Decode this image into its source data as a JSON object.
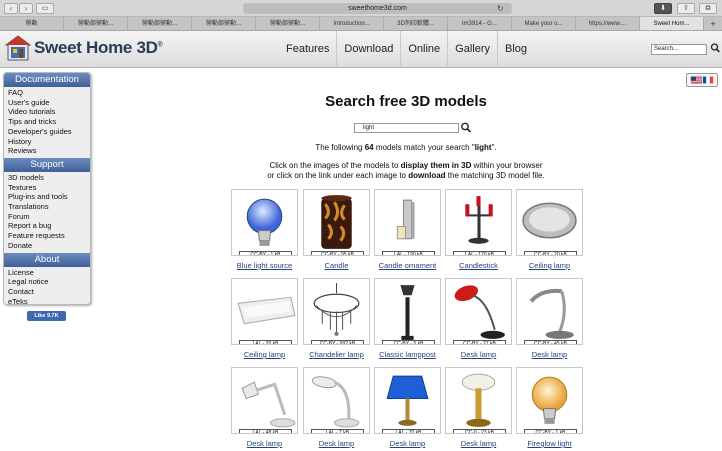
{
  "browser": {
    "url": "sweethome3d.com",
    "back_glyph": "‹",
    "forward_glyph": "›",
    "reload_glyph": "↻",
    "tabs": [
      {
        "label": "勞動"
      },
      {
        "label": "勞動部勞動..."
      },
      {
        "label": "勞動部勞動..."
      },
      {
        "label": "勞動部勞動..."
      },
      {
        "label": "勞動部勞動..."
      },
      {
        "label": "Introduction..."
      },
      {
        "label": "3D列印軟體..."
      },
      {
        "label": "lm3914 - G..."
      },
      {
        "label": "Make your o..."
      },
      {
        "label": "https://www...."
      },
      {
        "label": "Sweet Hom..."
      }
    ],
    "tab_add_glyph": "+"
  },
  "header": {
    "logo_text": "Sweet Home 3D",
    "logo_mark": "®",
    "nav": [
      "Features",
      "Download",
      "Online",
      "Gallery",
      "Blog"
    ],
    "search_value": "Search..."
  },
  "sidebar": {
    "sections": [
      {
        "title": "Documentation",
        "links": [
          "FAQ",
          "User's guide",
          "Video tutorials",
          "Tips and tricks",
          "Developer's guides",
          "History",
          "Reviews"
        ]
      },
      {
        "title": "Support",
        "links": [
          "3D models",
          "Textures",
          "Plug-ins and tools",
          "Translations",
          "Forum",
          "Report a bug",
          "Feature requests",
          "Donate"
        ]
      },
      {
        "title": "About",
        "links": [
          "License",
          "Legal notice",
          "Contact",
          "eTeks"
        ]
      }
    ],
    "like_label": "Like 9.7K"
  },
  "main": {
    "title": "Search free 3D models",
    "search_value": "light",
    "result_prefix": "The following ",
    "result_count": "64",
    "result_middle": " models match your search \"",
    "result_term": "light",
    "result_suffix": "\".",
    "info1_pre": "Click on the images of the models to ",
    "info1_bold": "display them in 3D",
    "info1_post": " within your browser",
    "info2_pre": "or click on the link under each image to ",
    "info2_bold": "download",
    "info2_post": " the matching 3D model file."
  },
  "models": [
    {
      "name": "Blue light source",
      "license": "CC-BY - 1 kB",
      "icon": "bulb-blue-icon"
    },
    {
      "name": "Candle",
      "license": "CC-BY - 95 kB",
      "icon": "candle-lantern-icon"
    },
    {
      "name": "Candle ornament",
      "license": "LAL - 190 kB",
      "icon": "candle-ornament-icon"
    },
    {
      "name": "Candlestick",
      "license": "LAL - 120 kB",
      "icon": "candlestick-icon"
    },
    {
      "name": "Ceiling lamp",
      "license": "CC-BY - 20 kB",
      "icon": "ceiling-disc-icon"
    },
    {
      "name": "Ceiling lamp",
      "license": "LAL - 20 kB",
      "icon": "ceiling-panel-icon"
    },
    {
      "name": "Chandelier lamp",
      "license": "CC-BY - 992 kB",
      "icon": "chandelier-icon"
    },
    {
      "name": "Classic lamppost",
      "license": "CC-BY - 5 kB",
      "icon": "lamppost-icon"
    },
    {
      "name": "Desk lamp",
      "license": "CC-BY - 27 kB",
      "icon": "desk-lamp-red-icon"
    },
    {
      "name": "Desk lamp",
      "license": "CC-BY - 45 kB",
      "icon": "desk-lamp-grey-icon"
    },
    {
      "name": "Desk lamp",
      "license": "LAL - 48 kB",
      "icon": "desk-lamp-white-icon"
    },
    {
      "name": "Desk lamp",
      "license": "LAL - 7 kB",
      "icon": "desk-lamp-arc-icon"
    },
    {
      "name": "Desk lamp",
      "license": "LAL - 70 kB",
      "icon": "table-lamp-blue-icon"
    },
    {
      "name": "Desk lamp",
      "license": "CC-0 - 23 kB",
      "icon": "table-lamp-brass-icon"
    },
    {
      "name": "Fireglow light",
      "license": "CC-BY - 1 kB",
      "icon": "bulb-fireglow-icon"
    }
  ]
}
